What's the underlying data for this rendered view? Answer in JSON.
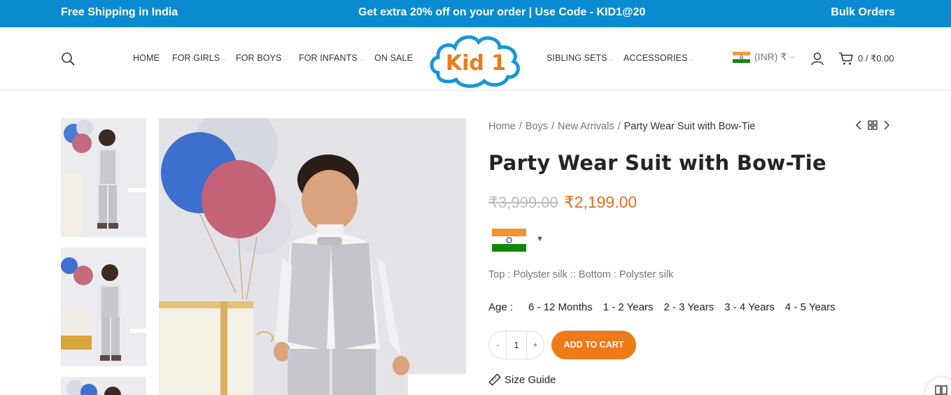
{
  "topbar": {
    "left": "Free Shipping in India",
    "center": "Get extra 20% off on your order | Use Code - KID1@20",
    "right": "Bulk Orders",
    "color": "#0a8bd1"
  },
  "header": {
    "nav_left": [
      {
        "label": "HOME",
        "dropdown": false
      },
      {
        "label": "FOR GIRLS",
        "dropdown": true
      },
      {
        "label": "FOR BOYS",
        "dropdown": true
      },
      {
        "label": "FOR INFANTS",
        "dropdown": true
      },
      {
        "label": "ON SALE",
        "dropdown": false
      }
    ],
    "logo_text": "Kid 1",
    "nav_right": [
      {
        "label": "SIBLING SETS",
        "dropdown": true
      },
      {
        "label": "ACCESSORIES",
        "dropdown": true
      }
    ],
    "currency": "(INR) ₹",
    "cart": "0 / ₹0.00",
    "icons": [
      "search-icon",
      "user-icon",
      "cart-icon",
      "chevron-down-icon"
    ]
  },
  "breadcrumb": {
    "items": [
      "Home",
      "Boys",
      "New Arrivals"
    ],
    "current": "Party Wear Suit with Bow-Tie"
  },
  "product": {
    "title": "Party Wear Suit with Bow-Tie",
    "price_old": "₹3,999.00",
    "price_new": "₹2,199.00",
    "price_color": "#e2701e",
    "material": "Top : Polyster silk :: Bottom : Polyster silk",
    "age_label": "Age :",
    "ages": [
      "6 - 12 Months",
      "1 - 2 Years",
      "2 - 3 Years",
      "3 - 4 Years",
      "4 - 5 Years"
    ],
    "quantity": "1",
    "qty_minus": "-",
    "qty_plus": "+",
    "add_to_cart": "ADD TO CART",
    "add_to_cart_color": "#ef7a1a",
    "size_guide": "Size Guide"
  }
}
